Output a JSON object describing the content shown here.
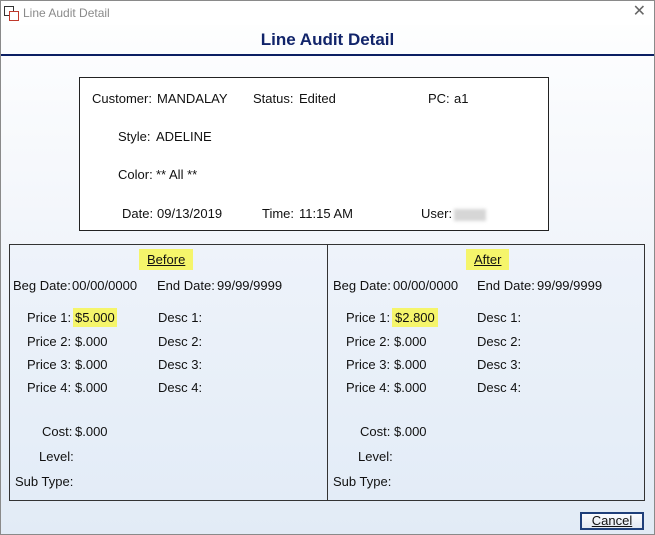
{
  "window": {
    "title": "Line Audit Detail"
  },
  "heading": "Line Audit Detail",
  "info": {
    "customer_label": "Customer:",
    "customer_value": "MANDALAY",
    "status_label": "Status:",
    "status_value": "Edited",
    "pc_label": "PC:",
    "pc_value": "a1",
    "style_label": "Style:",
    "style_value": "ADELINE",
    "color_label": "Color:",
    "color_value": "** All **",
    "date_label": "Date:",
    "date_value": "09/13/2019",
    "time_label": "Time:",
    "time_value": "11:15 AM",
    "user_label": "User:"
  },
  "before": {
    "title": "Before",
    "beg_date_label": "Beg Date:",
    "beg_date_value": "00/00/0000",
    "end_date_label": "End Date:",
    "end_date_value": "99/99/9999",
    "price1_label": "Price 1:",
    "price1_value": "$5.000",
    "price2_label": "Price 2:",
    "price2_value": "$.000",
    "price3_label": "Price 3:",
    "price3_value": "$.000",
    "price4_label": "Price 4:",
    "price4_value": "$.000",
    "desc1_label": "Desc 1:",
    "desc2_label": "Desc 2:",
    "desc3_label": "Desc 3:",
    "desc4_label": "Desc 4:",
    "cost_label": "Cost:",
    "cost_value": "$.000",
    "level_label": "Level:",
    "subtype_label": "Sub Type:"
  },
  "after": {
    "title": "After",
    "beg_date_label": "Beg Date:",
    "beg_date_value": "00/00/0000",
    "end_date_label": "End Date:",
    "end_date_value": "99/99/9999",
    "price1_label": "Price 1:",
    "price1_value": "$2.800",
    "price2_label": "Price 2:",
    "price2_value": "$.000",
    "price3_label": "Price 3:",
    "price3_value": "$.000",
    "price4_label": "Price 4:",
    "price4_value": "$.000",
    "desc1_label": "Desc 1:",
    "desc2_label": "Desc 2:",
    "desc3_label": "Desc 3:",
    "desc4_label": "Desc 4:",
    "cost_label": "Cost:",
    "cost_value": "$.000",
    "level_label": "Level:",
    "subtype_label": "Sub Type:"
  },
  "buttons": {
    "cancel": "Cancel"
  },
  "colors": {
    "heading": "#11246a",
    "highlight": "#f5f56b",
    "panel_bg": "#e3ecf7"
  },
  "icons": {
    "app": "app-window-icon",
    "close": "close-icon"
  }
}
